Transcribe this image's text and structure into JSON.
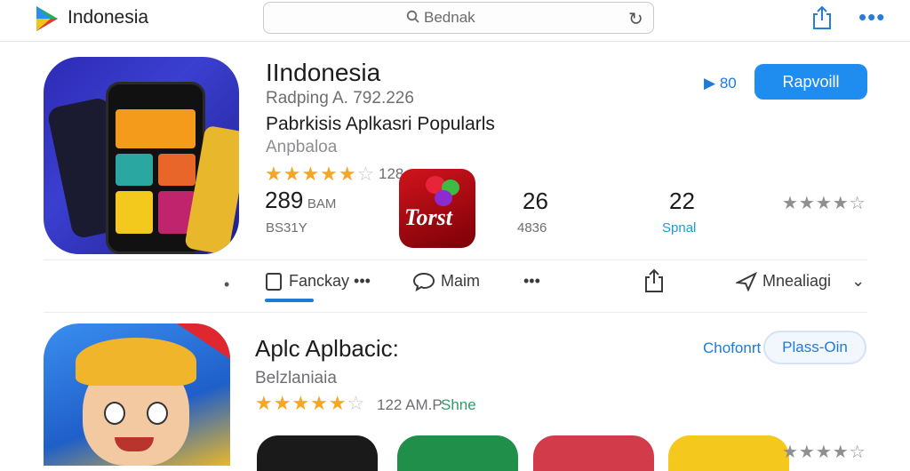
{
  "header": {
    "logo_text": "Indonesia",
    "search_text": "Bednak",
    "search_icon": "search-icon",
    "refresh_icon": "refresh-icon",
    "share_icon": "share-icon",
    "more_icon": "more-icon"
  },
  "app1": {
    "title": "IIndonesia",
    "subtitle": "Radping A. 792.226",
    "tagline": "Pabrkisis Aplkasri Popularls",
    "category": "Anpbaloa",
    "stars_filled": 5,
    "stars_empty": 1,
    "rating_count": "128",
    "play_label": "80",
    "get_label": "Rapvoill",
    "stats": [
      {
        "big": "289",
        "small": "BAM",
        "sub": "BS31Y"
      },
      {
        "big": "26",
        "small": "",
        "sub": "4836"
      },
      {
        "big": "22",
        "small": "",
        "sub": "Spnal"
      }
    ],
    "badge_text": "Torst",
    "grey_stars": 4
  },
  "actions": {
    "item1": "Fanckay",
    "item2": "Maim",
    "item3": "Mnealiagi"
  },
  "app2": {
    "title": "Aplc Aplbacic:",
    "subtitle": "Belzlaniaia",
    "stars_filled": 5,
    "stars_empty": 1,
    "rating_count": "122 AM.P",
    "rating_share": "Shne",
    "link_label": "Chofonrt",
    "button_label": "Plass-Oin"
  },
  "colors": {
    "accent": "#1f8cf0",
    "star": "#f5a623",
    "badge": "#d0141c"
  }
}
